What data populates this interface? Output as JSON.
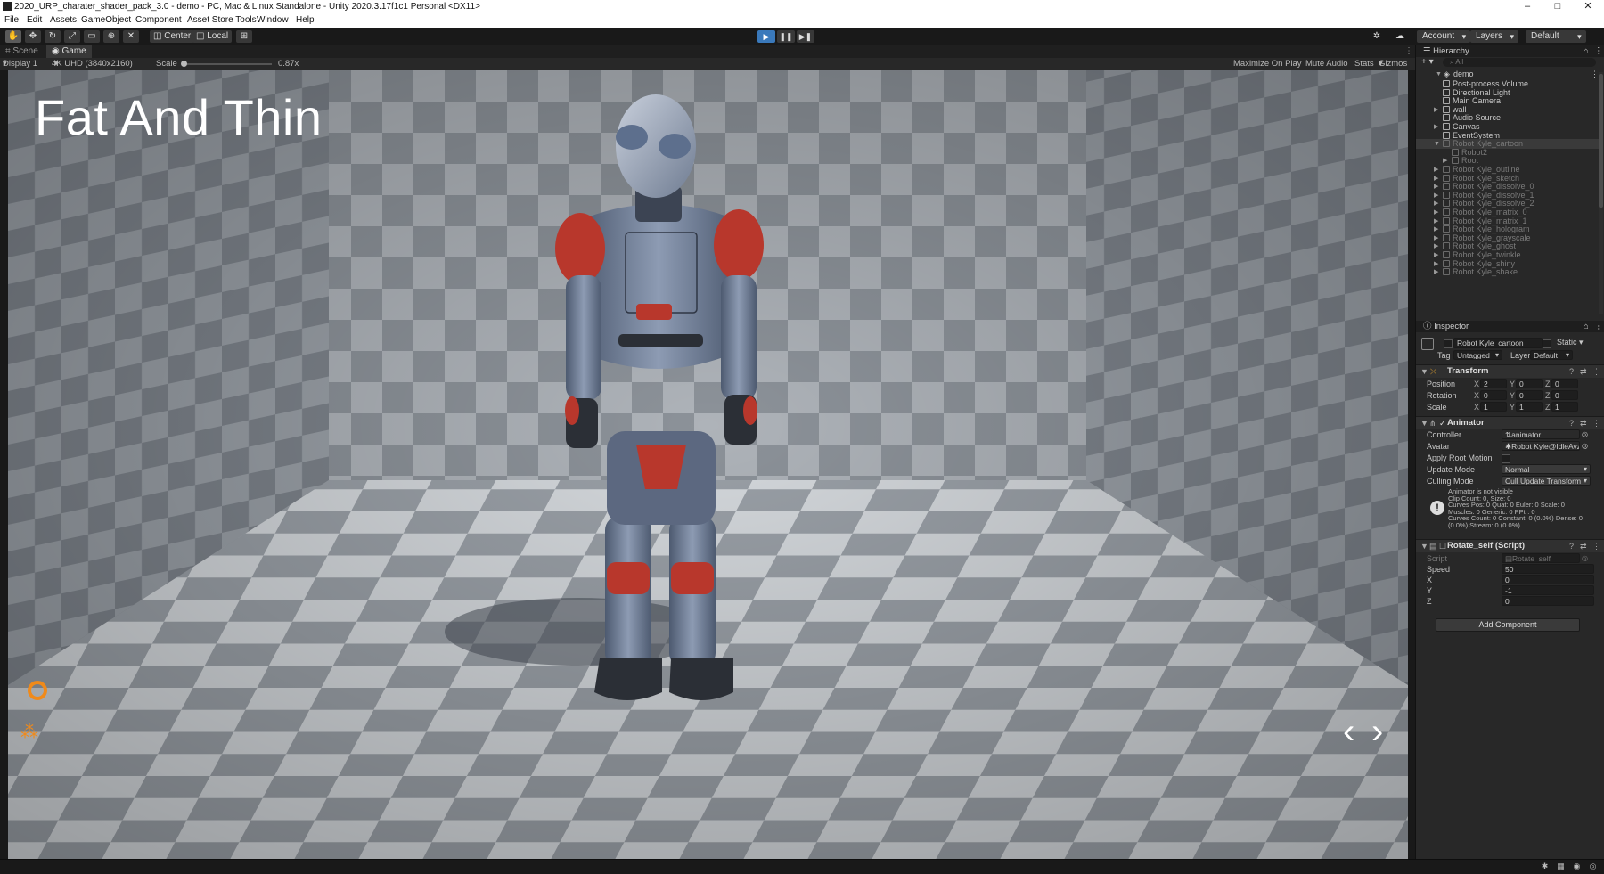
{
  "window": {
    "title": "2020_URP_charater_shader_pack_3.0 - demo - PC, Mac & Linux Standalone - Unity 2020.3.17f1c1 Personal <DX11>",
    "minimize": "–",
    "maximize": "□",
    "close": "✕"
  },
  "menu": [
    "File",
    "Edit",
    "Assets",
    "GameObject",
    "Component",
    "Asset Store Tools",
    "Window",
    "Help"
  ],
  "toolbar": {
    "pivot_label": "Center",
    "space_label": "Local",
    "account_label": "Account",
    "layers_label": "Layers",
    "layout_label": "Default",
    "play_state": "playing"
  },
  "view_tabs": {
    "scene": "Scene",
    "game": "Game"
  },
  "game_bar": {
    "display": "Display 1",
    "resolution": "4K UHD (3840x2160)",
    "scale_label": "Scale",
    "scale_value": "0.87x",
    "maximize_on_play": "Maximize On Play",
    "mute_audio": "Mute Audio",
    "stats": "Stats",
    "gizmos": "Gizmos"
  },
  "game_view": {
    "title": "Fat And Thin",
    "prev_arrow": "‹",
    "next_arrow": "›"
  },
  "hierarchy": {
    "title": "Hierarchy",
    "search_placeholder": "All",
    "root": "demo",
    "items": [
      {
        "label": "Post-process Volume",
        "state": "normal"
      },
      {
        "label": "Directional Light",
        "state": "normal"
      },
      {
        "label": "Main Camera",
        "state": "normal"
      },
      {
        "label": "wall",
        "state": "normal"
      },
      {
        "label": "Audio Source",
        "state": "normal"
      },
      {
        "label": "Canvas",
        "state": "normal"
      },
      {
        "label": "EventSystem",
        "state": "normal"
      },
      {
        "label": "Robot Kyle_cartoon",
        "state": "selected"
      },
      {
        "label": "Robot2",
        "state": "dim"
      },
      {
        "label": "Root",
        "state": "dim"
      },
      {
        "label": "Robot Kyle_outline",
        "state": "dim"
      },
      {
        "label": "Robot Kyle_sketch",
        "state": "dim"
      },
      {
        "label": "Robot Kyle_dissolve_0",
        "state": "dim"
      },
      {
        "label": "Robot Kyle_dissolve_1",
        "state": "dim"
      },
      {
        "label": "Robot Kyle_dissolve_2",
        "state": "dim"
      },
      {
        "label": "Robot Kyle_matrix_0",
        "state": "dim"
      },
      {
        "label": "Robot Kyle_matrix_1",
        "state": "dim"
      },
      {
        "label": "Robot Kyle_hologram",
        "state": "dim"
      },
      {
        "label": "Robot Kyle_grayscale",
        "state": "dim"
      },
      {
        "label": "Robot Kyle_ghost",
        "state": "dim"
      },
      {
        "label": "Robot Kyle_twinkle",
        "state": "dim"
      },
      {
        "label": "Robot Kyle_shiny",
        "state": "dim"
      },
      {
        "label": "Robot Kyle_shake",
        "state": "dim"
      }
    ]
  },
  "inspector": {
    "title": "Inspector",
    "object_name": "Robot Kyle_cartoon",
    "static_label": "Static",
    "tag_label": "Tag",
    "tag_value": "Untagged",
    "layer_label": "Layer",
    "layer_value": "Default",
    "transform": {
      "header": "Transform",
      "position_label": "Position",
      "rotation_label": "Rotation",
      "scale_label": "Scale",
      "position": {
        "x": "2",
        "y": "0",
        "z": "0"
      },
      "rotation": {
        "x": "0",
        "y": "0",
        "z": "0"
      },
      "scale": {
        "x": "1",
        "y": "1",
        "z": "1"
      }
    },
    "animator": {
      "header": "Animator",
      "controller_label": "Controller",
      "controller_value": "animator",
      "avatar_label": "Avatar",
      "avatar_value": "Robot Kyle@IdleAvz",
      "apply_root_motion_label": "Apply Root Motion",
      "update_mode_label": "Update Mode",
      "update_mode_value": "Normal",
      "culling_mode_label": "Culling Mode",
      "culling_mode_value": "Cull Update Transform",
      "info_lines": [
        "Animator is not visible",
        "Clip Count: 0, Size: 0",
        "Curves Pos: 0 Quat: 0 Euler: 0 Scale: 0",
        "Muscles: 0 Generic: 0 PPtr: 0",
        "Curves Count: 0 Constant: 0 (0.0%) Dense: 0",
        "(0.0%) Stream: 0 (0.0%)"
      ]
    },
    "rotate_self": {
      "header": "Rotate_self (Script)",
      "script_label": "Script",
      "script_value": "Rotate_self",
      "speed_label": "Speed",
      "speed_value": "50",
      "x_label": "X",
      "x_value": "0",
      "y_label": "Y",
      "y_value": "-1",
      "z_label": "Z",
      "z_value": "0"
    },
    "add_component": "Add Component"
  },
  "colors": {
    "play_active": "#3a79bb",
    "robot_accent": "#b8372c",
    "robot_body": "#6f7f98",
    "floor_light": "#cfd4d9",
    "floor_dark": "#8e959d",
    "orange_icon": "#f08a1a"
  }
}
